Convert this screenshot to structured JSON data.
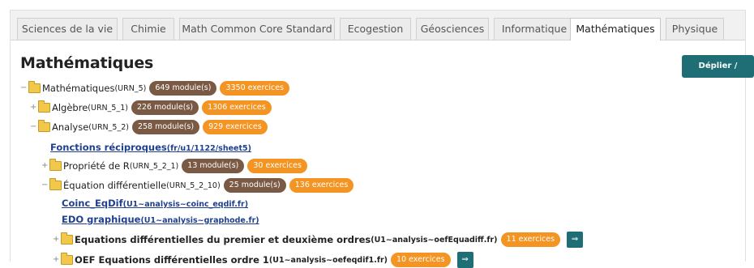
{
  "tabs": [
    {
      "label": "Sciences de la vie"
    },
    {
      "label": "Chimie"
    },
    {
      "label": "Math Common Core Standard"
    },
    {
      "label": "Ecogestion"
    },
    {
      "label": "Géosciences"
    },
    {
      "label": "Informatique"
    },
    {
      "label": "Mathématiques",
      "active": true
    },
    {
      "label": "Physique"
    }
  ],
  "page_title": "Mathématiques",
  "toggle_button": "Déplier / Replier",
  "tree": {
    "root": {
      "name": "Mathématiques",
      "urn": "(URN_5)",
      "modules": "649 module(s)",
      "exercises": "3350 exercices"
    },
    "algebre": {
      "name": "Algèbre",
      "urn": "(URN_5_1)",
      "modules": "226 module(s)",
      "exercises": "1306 exercices"
    },
    "analyse": {
      "name": "Analyse",
      "urn": "(URN_5_2)",
      "modules": "258 module(s)",
      "exercises": "929 exercices"
    },
    "fonctions": {
      "name": "Fonctions réciproques",
      "path": "(fr/u1/1122/sheet5)"
    },
    "propriete": {
      "name": "Propriété de R",
      "urn": "(URN_5_2_1)",
      "modules": "13 module(s)",
      "exercises": "30 exercices"
    },
    "equation": {
      "name": "Équation différentielle",
      "urn": "(URN_5_2_10)",
      "modules": "25 module(s)",
      "exercises": "136 exercices"
    },
    "coinc": {
      "name": "Coinc_EqDif",
      "path": "(U1~analysis~coinc_eqdif.fr)"
    },
    "edo": {
      "name": "EDO graphique",
      "path": "(U1~analysis~graphode.fr)"
    },
    "oef_premier": {
      "name": "Equations différentielles du premier et deuxième ordres",
      "path": "(U1~analysis~oefEquadiff.fr)",
      "exercises": "11 exercices"
    },
    "oef_ordre1": {
      "name": "OEF Equations différentielles ordre 1",
      "path": "(U1~analysis~oefeqdif1.fr)",
      "exercises": "10 exercices"
    }
  },
  "icons": {
    "folder": "folder-icon",
    "expand": "plus-icon",
    "collapse": "minus-icon",
    "go": "arrow-right-icon"
  },
  "colors": {
    "accent": "#1f6e75",
    "module_badge": "#7a5a44",
    "exercise_badge": "#f39423",
    "link": "#1f3f8f"
  }
}
